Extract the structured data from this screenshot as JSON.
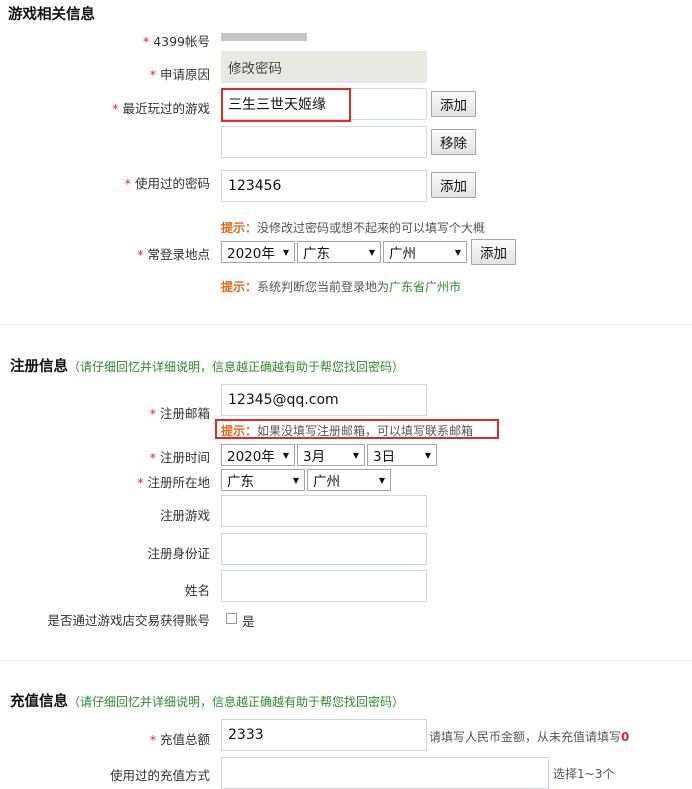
{
  "game_section": {
    "title": "游戏相关信息",
    "account_label": "4399帐号",
    "reason_label": "申请原因",
    "reason_value": "修改密码",
    "recent_game_label": "最近玩过的游戏",
    "recent_game_value": "三生三世天姬缘",
    "recent_game2_value": "",
    "add_label": "添加",
    "remove_label": "移除",
    "password_label": "使用过的密码",
    "password_value": "123456",
    "tip_prefix": "提示：",
    "password_tip": "没修改过密码或想不起来的可以填写个大概",
    "location_label": "常登录地点",
    "location_year": "2020年",
    "location_province": "广东",
    "location_city": "广州",
    "location_tip_text": "系统判断您当前登录地为",
    "location_tip_place": "广东省广州市"
  },
  "register_section": {
    "title": "注册信息",
    "subtitle": "（请仔细回忆并详细说明，信息越正确越有助于帮您找回密码）",
    "email_label": "注册邮箱",
    "email_value": "12345@qq.com",
    "email_tip": "如果没填写注册邮箱，可以填写联系邮箱",
    "time_label": "注册时间",
    "time_year": "2020年",
    "time_month": "3月",
    "time_day": "3日",
    "place_label": "注册所在地",
    "place_province": "广东",
    "place_city": "广州",
    "game_label": "注册游戏",
    "game_value": "",
    "idcard_label": "注册身份证",
    "idcard_value": "",
    "name_label": "姓名",
    "name_value": "",
    "shop_label": "是否通过游戏店交易获得账号",
    "shop_yes": "是"
  },
  "recharge_section": {
    "title": "充值信息",
    "subtitle": "（请仔细回忆并详细说明，信息越正确越有助于帮您找回密码）",
    "total_label": "充值总额",
    "total_value": "2333",
    "total_hint": "请填写人民币金额，从未充值请填写",
    "total_hint_zero": "0",
    "method_label": "使用过的充值方式",
    "method_value": "",
    "method_hint": "选择1~3个"
  },
  "colors": {
    "required_star": "#e0292a",
    "tip_orange": "#e8661a",
    "subtitle_green": "#2e8b2e",
    "highlight_box": "#e0292a"
  }
}
